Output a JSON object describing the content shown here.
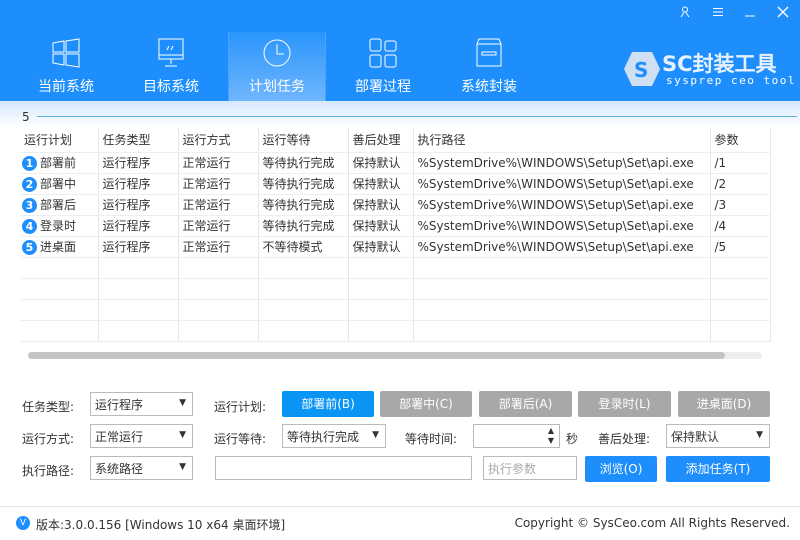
{
  "window": {
    "controls": [
      "user-icon",
      "menu-icon",
      "minimize-icon",
      "close-icon"
    ]
  },
  "nav": {
    "tabs": [
      {
        "label": "当前系统",
        "icon": "windows-icon"
      },
      {
        "label": "目标系统",
        "icon": "monitor-icon"
      },
      {
        "label": "计划任务",
        "icon": "clock-icon"
      },
      {
        "label": "部署过程",
        "icon": "blocks-icon"
      },
      {
        "label": "系统封装",
        "icon": "box-icon"
      }
    ],
    "active": 2
  },
  "logo": {
    "title": "SC封装工具",
    "subtitle": "sysprep ceo tool"
  },
  "task_count": "5",
  "table": {
    "columns": [
      "运行计划",
      "任务类型",
      "运行方式",
      "运行等待",
      "善后处理",
      "执行路径",
      "参数"
    ],
    "rows": [
      [
        "1",
        "部署前",
        "运行程序",
        "正常运行",
        "等待执行完成",
        "保持默认",
        "%SystemDrive%\\WINDOWS\\Setup\\Set\\api.exe",
        "/1"
      ],
      [
        "2",
        "部署中",
        "运行程序",
        "正常运行",
        "等待执行完成",
        "保持默认",
        "%SystemDrive%\\WINDOWS\\Setup\\Set\\api.exe",
        "/2"
      ],
      [
        "3",
        "部署后",
        "运行程序",
        "正常运行",
        "等待执行完成",
        "保持默认",
        "%SystemDrive%\\WINDOWS\\Setup\\Set\\api.exe",
        "/3"
      ],
      [
        "4",
        "登录时",
        "运行程序",
        "正常运行",
        "等待执行完成",
        "保持默认",
        "%SystemDrive%\\WINDOWS\\Setup\\Set\\api.exe",
        "/4"
      ],
      [
        "5",
        "进桌面",
        "运行程序",
        "正常运行",
        "不等待模式",
        "保持默认",
        "%SystemDrive%\\WINDOWS\\Setup\\Set\\api.exe",
        "/5"
      ]
    ]
  },
  "form": {
    "task_type_label": "任务类型:",
    "task_type": "运行程序",
    "run_plan_label": "运行计划:",
    "plans": [
      "部署前(B)",
      "部署中(C)",
      "部署后(A)",
      "登录时(L)",
      "进桌面(D)"
    ],
    "run_mode_label": "运行方式:",
    "run_mode": "正常运行",
    "run_wait_label": "运行等待:",
    "run_wait": "等待执行完成",
    "wait_time_label": "等待时间:",
    "wait_time": "",
    "seconds": "秒",
    "after_label": "善后处理:",
    "after": "保持默认",
    "path_label": "执行路径:",
    "path_type": "系统路径",
    "path": "",
    "params_placeholder": "执行参数",
    "browse": "浏览(O)",
    "add": "添加任务(T)"
  },
  "footer": {
    "version": "版本:3.0.0.156 [Windows 10 x64 桌面环境]",
    "copyright": "Copyright © SysCeo.com All Rights Reserved."
  }
}
